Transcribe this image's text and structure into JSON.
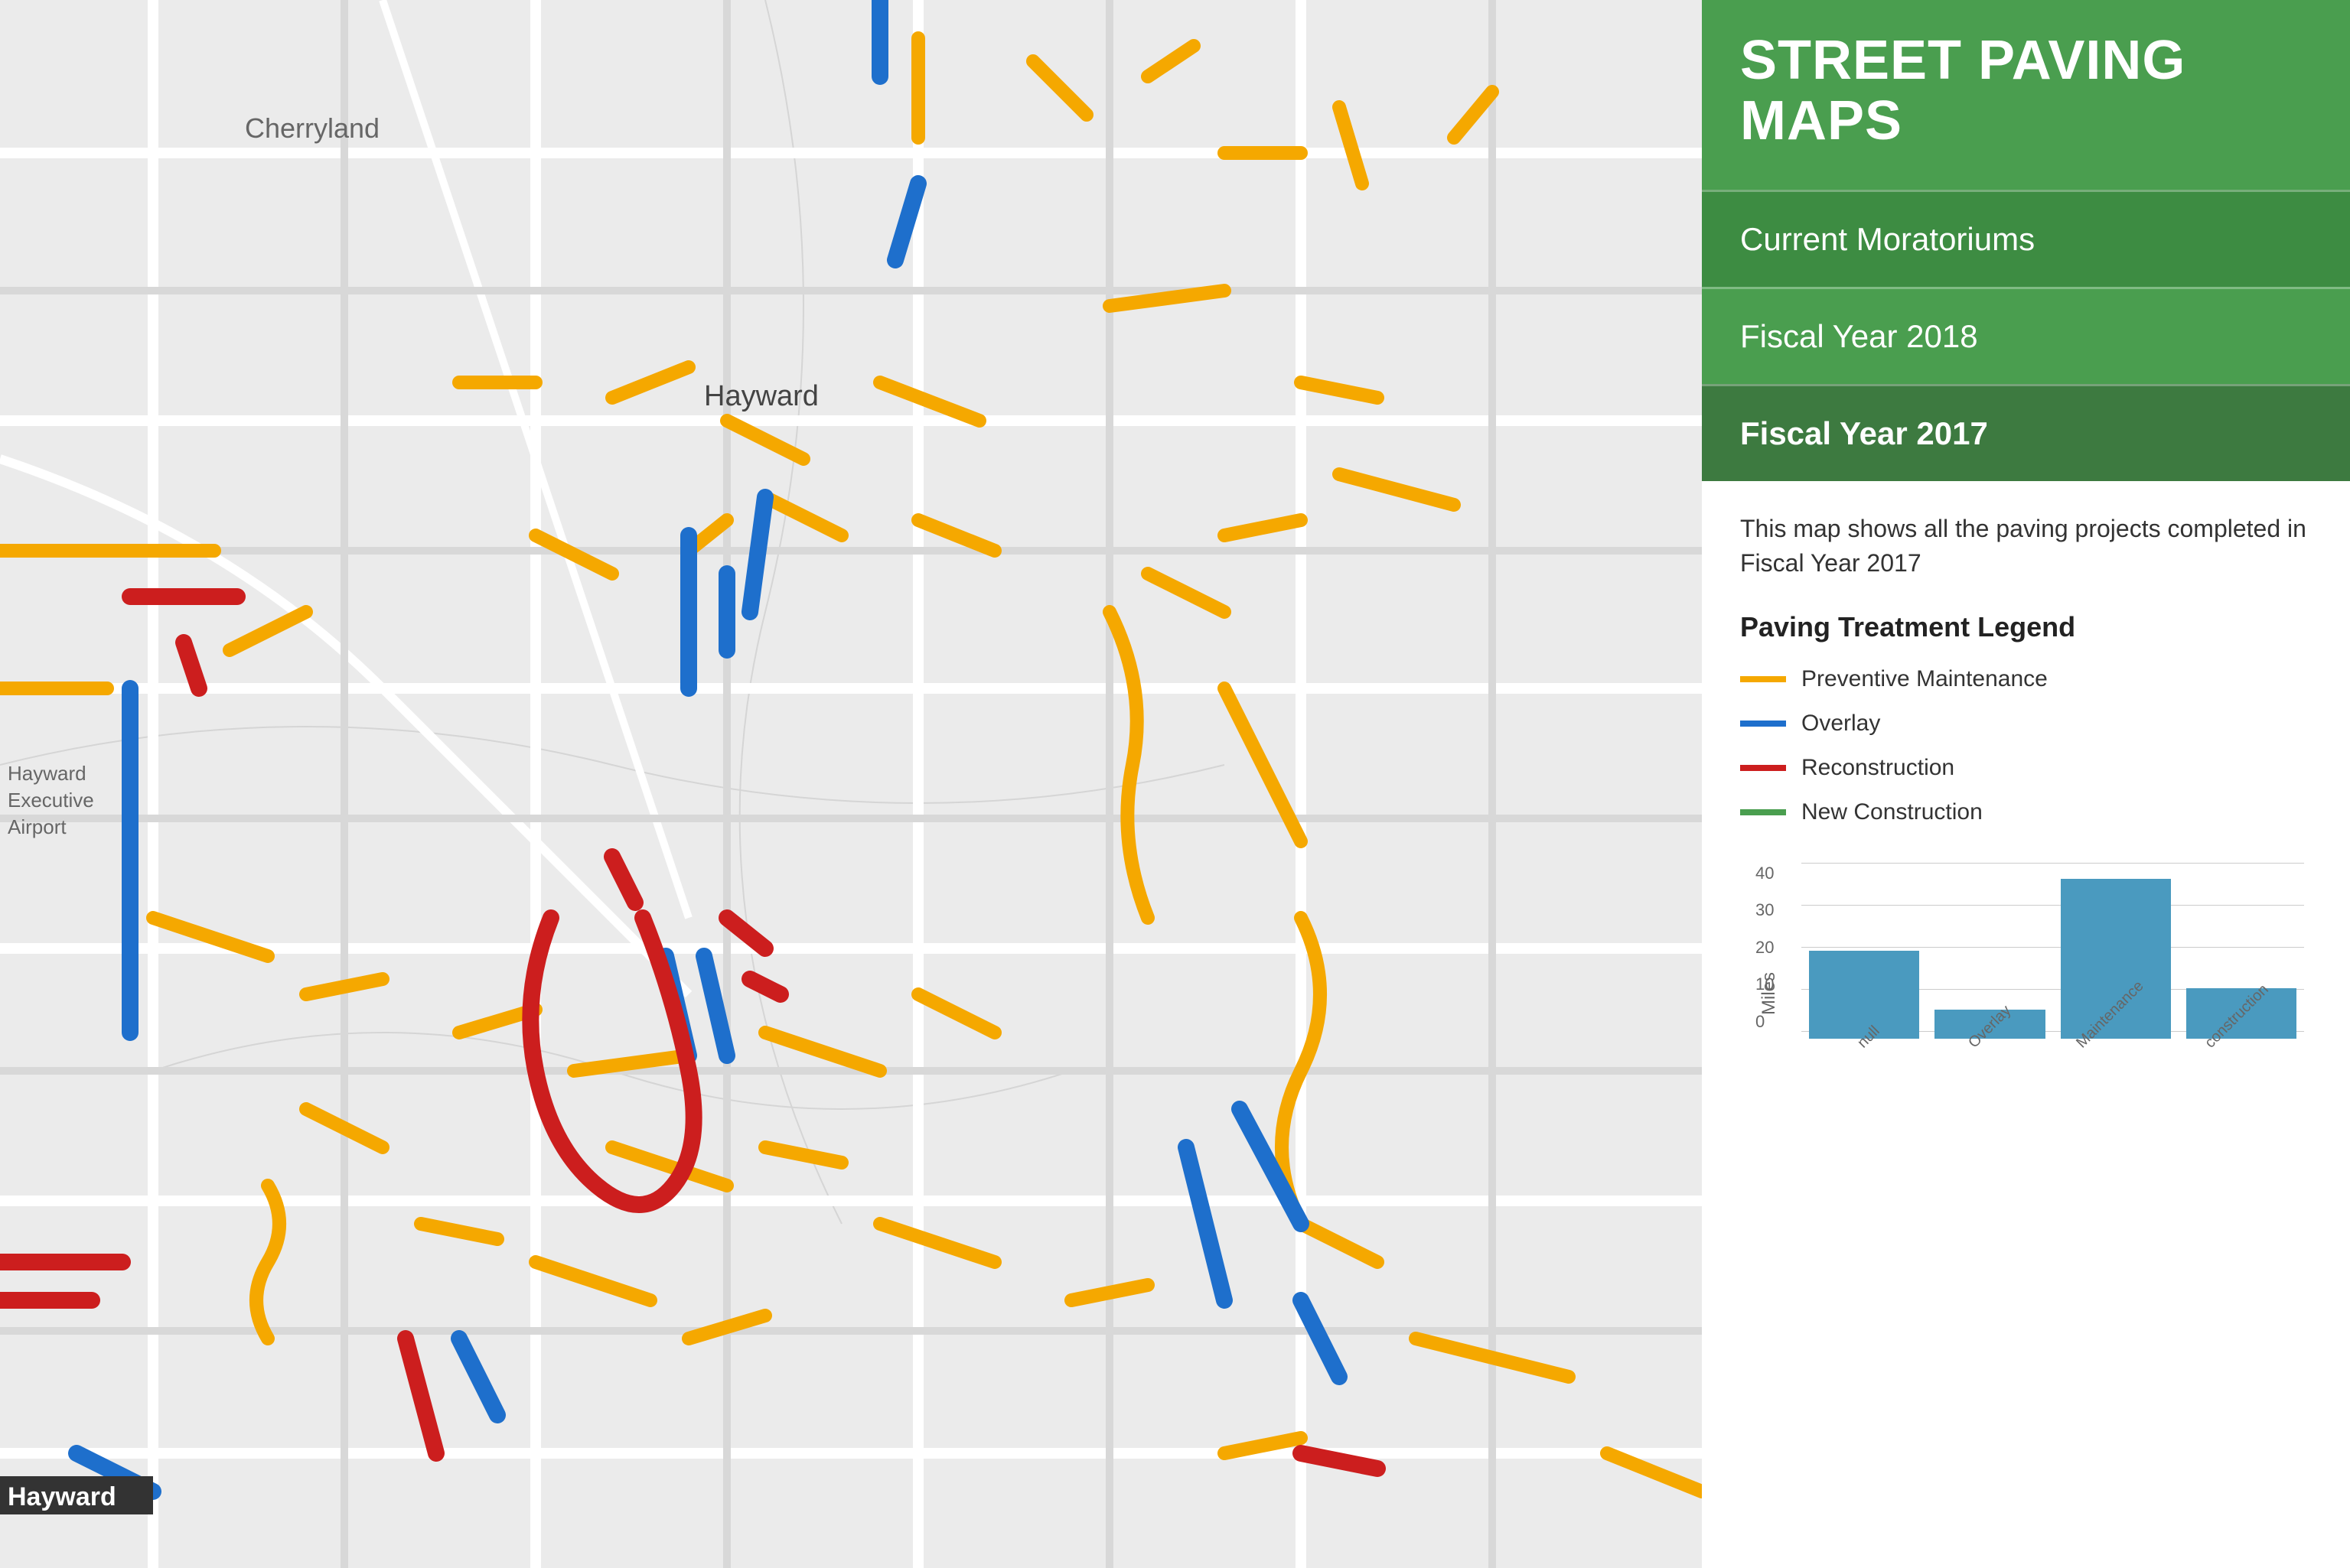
{
  "sidebar": {
    "header": {
      "title": "STREET PAVING MAPS"
    },
    "nav": [
      {
        "id": "moratoriums",
        "label": "Current Moratoriums",
        "active": false
      },
      {
        "id": "fy2018",
        "label": "Fiscal Year 2018",
        "active": false
      },
      {
        "id": "fy2017",
        "label": "Fiscal Year 2017",
        "active": true
      }
    ],
    "description": "This map shows all the paving projects completed in Fiscal Year 2017",
    "legend_title": "Paving Treatment Legend",
    "legend_items": [
      {
        "id": "preventive",
        "color": "#f5a800",
        "label": "Preventive Maintenance"
      },
      {
        "id": "overlay",
        "color": "#1e6fcc",
        "label": "Overlay"
      },
      {
        "id": "reconstruction",
        "color": "#cc1e1e",
        "label": "Reconstruction"
      },
      {
        "id": "new-construction",
        "color": "#4a9e4f",
        "label": "New Construction"
      }
    ],
    "chart": {
      "y_label": "Miles",
      "y_ticks": [
        "0",
        "10",
        "20",
        "30",
        "40"
      ],
      "bars": [
        {
          "label": "null",
          "value": 21,
          "max": 40
        },
        {
          "label": "Overlay",
          "value": 7,
          "max": 40
        },
        {
          "label": "Maintenance",
          "value": 38,
          "max": 40
        },
        {
          "label": "construction",
          "value": 12,
          "max": 40
        }
      ]
    }
  },
  "map": {
    "labels": [
      {
        "id": "cherryland",
        "text": "Cherryland"
      },
      {
        "id": "hayward",
        "text": "Hayward"
      },
      {
        "id": "hayward-bottom",
        "text": "Hayward"
      },
      {
        "id": "airport",
        "text": "Hayward Executive Airport"
      }
    ]
  }
}
